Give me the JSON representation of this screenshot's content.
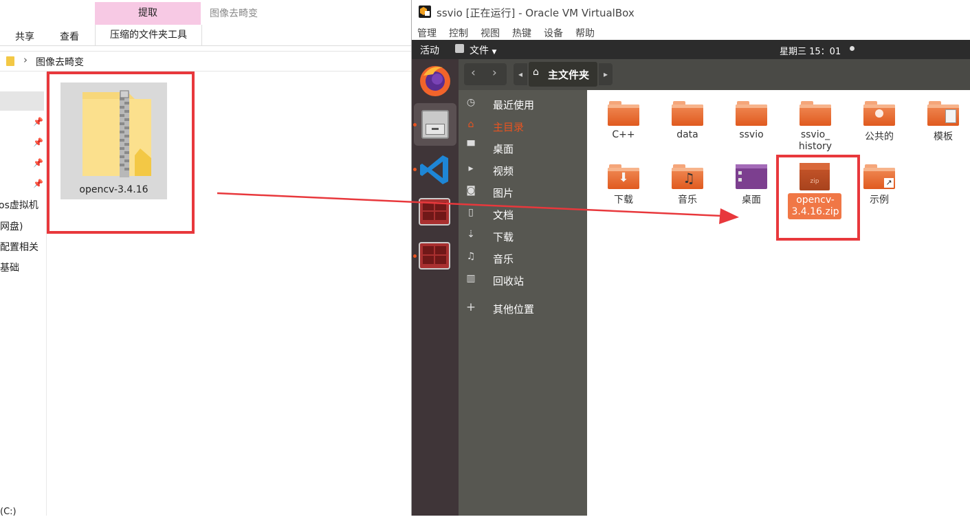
{
  "explorer": {
    "ribbon": {
      "context_header": "提取",
      "window_title": "图像去畸变",
      "tabs": [
        "共享",
        "查看"
      ],
      "context_tab": "压缩的文件夹工具"
    },
    "address": {
      "path": "图像去畸变"
    },
    "nav_items": [
      "os虚拟机",
      "网盘)",
      "配置相关",
      "基础",
      "(C:)"
    ],
    "file": {
      "name": "opencv-3.4.16"
    }
  },
  "vbox": {
    "title": "ssvio [正在运行] - Oracle VM VirtualBox",
    "menu": [
      "管理",
      "控制",
      "视图",
      "热键",
      "设备",
      "帮助"
    ],
    "topbar": {
      "activities": "活动",
      "app_menu": "文件",
      "clock": "星期三 15：01"
    },
    "header": {
      "location": "主文件夹"
    },
    "sidebar": [
      {
        "label": "最近使用",
        "icon": "clock-icon"
      },
      {
        "label": "主目录",
        "icon": "home-icon",
        "active": true
      },
      {
        "label": "桌面",
        "icon": "desktop-folder-icon"
      },
      {
        "label": "视频",
        "icon": "video-icon"
      },
      {
        "label": "图片",
        "icon": "camera-icon"
      },
      {
        "label": "文档",
        "icon": "document-icon"
      },
      {
        "label": "下载",
        "icon": "download-icon"
      },
      {
        "label": "音乐",
        "icon": "music-icon"
      },
      {
        "label": "回收站",
        "icon": "trash-icon"
      },
      {
        "label": "其他位置",
        "icon": "plus-icon"
      }
    ],
    "files": [
      {
        "name": "C++"
      },
      {
        "name": "data"
      },
      {
        "name": "ssvio"
      },
      {
        "name": "ssvio_\nhistory"
      },
      {
        "name": "公共的"
      },
      {
        "name": "模板"
      },
      {
        "name": "下载"
      },
      {
        "name": "音乐"
      },
      {
        "name": "桌面"
      },
      {
        "name": "opencv-\n3.4.16.zip",
        "zip_badge": "zip"
      },
      {
        "name": "示例"
      }
    ]
  },
  "colors": {
    "ubuntu_orange": "#e95420",
    "highlight_red": "#e8383c",
    "ctx_pink": "#f7c9e4"
  }
}
